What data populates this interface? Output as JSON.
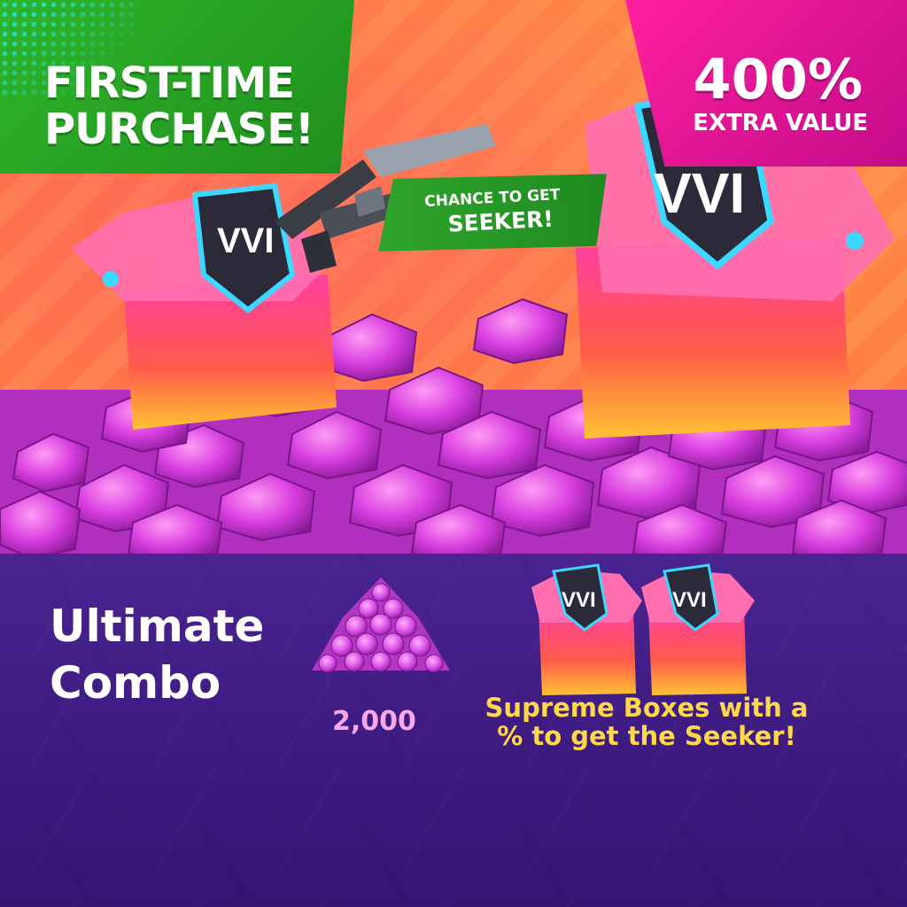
{
  "header": {
    "first_time_line1": "FIRST-TIME",
    "first_time_line2": "PURCHASE!",
    "extra_percent": "400%",
    "extra_label": "EXTRA VALUE",
    "chance_line1": "CHANCE TO GET",
    "chance_line2": "SEEKER!"
  },
  "offer": {
    "title_line1": "Ultimate",
    "title_line2": "Combo",
    "gem_amount": "2,000",
    "boxes_line1": "Supreme Boxes with a",
    "boxes_line2": "% to get the Seeker!"
  },
  "icons": {
    "gem": "gem-icon",
    "supreme_box": "supreme-box-icon",
    "crossbow": "crossbow-icon"
  },
  "colors": {
    "green_badge": "#2fb52a",
    "pink_badge": "#ff1f9f",
    "gem": "#d94ee8",
    "purple_bg": "#3f1c84",
    "yellow_text": "#ffd84a"
  }
}
